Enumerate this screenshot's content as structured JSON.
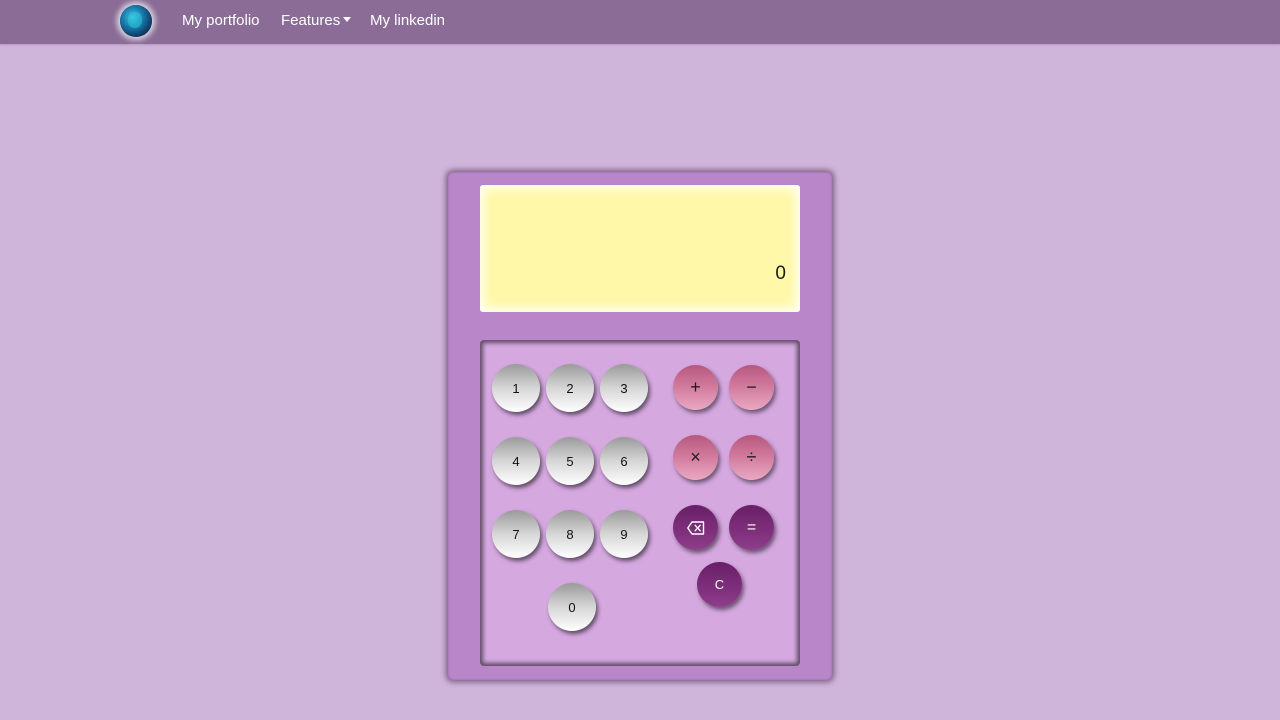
{
  "navbar": {
    "logo": "globe-logo",
    "links": {
      "portfolio": "My portfolio",
      "features": "Features",
      "linkedin": "My linkedin"
    }
  },
  "calculator": {
    "display": "0",
    "digits": [
      "1",
      "2",
      "3",
      "4",
      "5",
      "6",
      "7",
      "8",
      "9",
      "0"
    ],
    "operators": {
      "add": "+",
      "subtract": "−",
      "multiply": "×",
      "divide": "÷",
      "equals": "=",
      "clear": "C",
      "backspace": "backspace-icon"
    }
  },
  "colors": {
    "page_background": "#d0b5da",
    "navbar": "#8a6c96",
    "calculator_body": "#b886c9",
    "display": "#fff8a8",
    "keypad": "#d5a8e0",
    "operator_buttons": "#d27c9e",
    "function_buttons": "#7d2e7a"
  }
}
